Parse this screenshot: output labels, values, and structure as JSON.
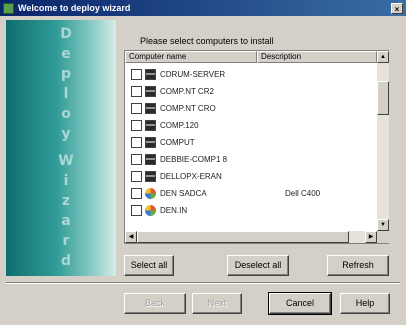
{
  "window": {
    "title": "Welcome to deploy wizard",
    "close_glyph": "×"
  },
  "banner": {
    "word": [
      "D",
      "e",
      "p",
      "l",
      "o",
      "y",
      "W",
      "i",
      "z",
      "a",
      "r",
      "d"
    ]
  },
  "main": {
    "instruction": "Please select computers to install",
    "columns": [
      "Computer name",
      "Description"
    ],
    "computers": [
      {
        "name": "CDRUM-SERVER",
        "description": "",
        "icon": "computer-icon",
        "checked": false
      },
      {
        "name": "COMP.NT CR2",
        "description": "",
        "icon": "computer-icon",
        "checked": false
      },
      {
        "name": "COMP.NT CRO",
        "description": "",
        "icon": "computer-icon",
        "checked": false
      },
      {
        "name": "COMP.120",
        "description": "",
        "icon": "computer-icon",
        "checked": false
      },
      {
        "name": "COMPUT",
        "description": "",
        "icon": "computer-icon",
        "checked": false
      },
      {
        "name": "DEBBIE-COMP1 8",
        "description": "",
        "icon": "computer-icon",
        "checked": false
      },
      {
        "name": "DELLOPX-ERAN",
        "description": "",
        "icon": "computer-icon",
        "checked": false
      },
      {
        "name": "DEN SADCA",
        "description": "Dell C400",
        "icon": "globe-icon",
        "checked": false
      },
      {
        "name": "DEN.IN",
        "description": "",
        "icon": "globe-icon",
        "checked": false
      }
    ],
    "select_all_label": "Select all",
    "deselect_all_label": "Deselect all",
    "refresh_label": "Refresh"
  },
  "footer": {
    "back_label": "Back",
    "next_label": "Next",
    "cancel_label": "Cancel",
    "help_label": "Help"
  }
}
